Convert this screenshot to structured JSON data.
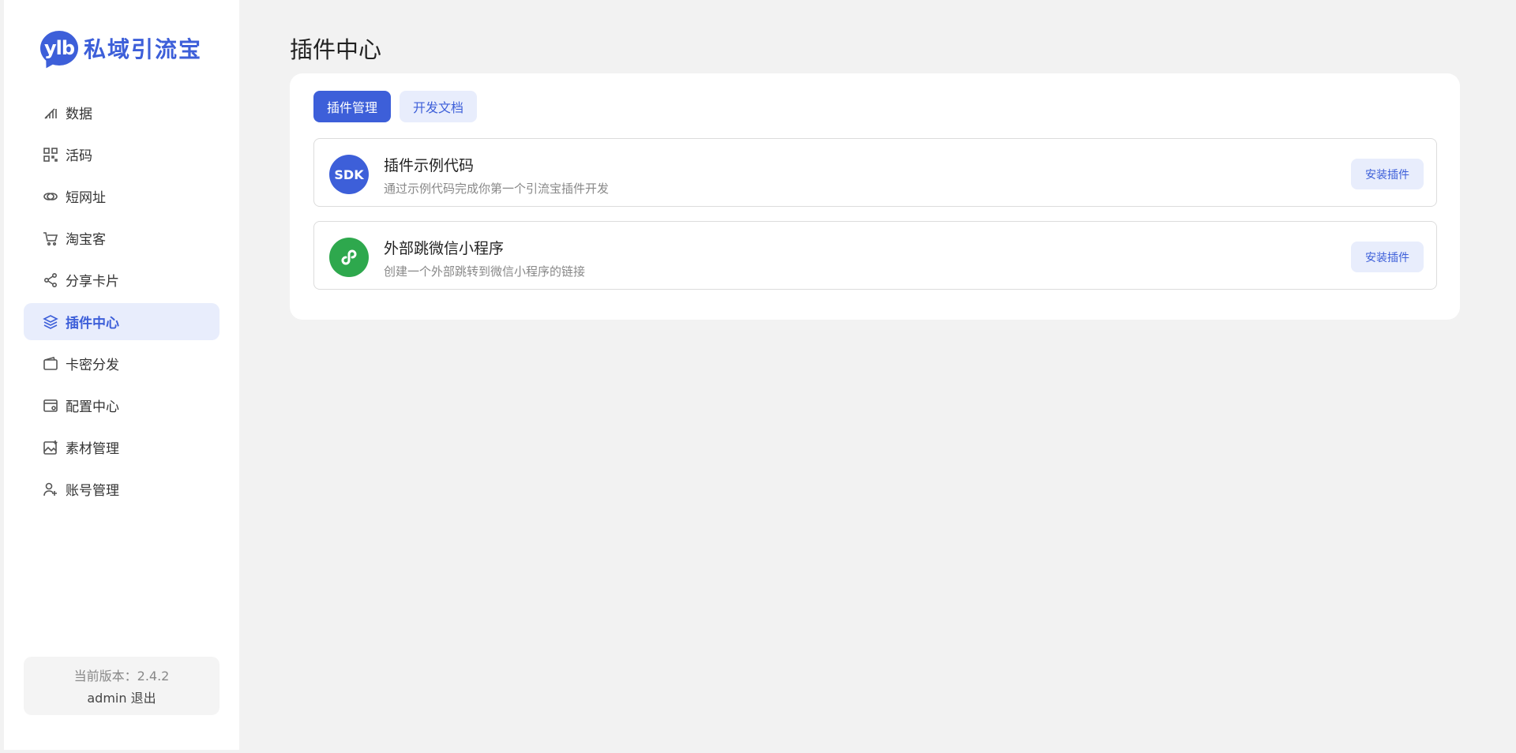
{
  "brand": {
    "badge": "ylb",
    "name": "私域引流宝",
    "color": "#3d5fd9"
  },
  "sidebar": {
    "items": [
      {
        "label": "数据",
        "icon": "chart-icon",
        "active": false
      },
      {
        "label": "活码",
        "icon": "qrcode-icon",
        "active": false
      },
      {
        "label": "短网址",
        "icon": "link-icon",
        "active": false
      },
      {
        "label": "淘宝客",
        "icon": "cart-icon",
        "active": false
      },
      {
        "label": "分享卡片",
        "icon": "share-icon",
        "active": false
      },
      {
        "label": "插件中心",
        "icon": "layers-icon",
        "active": true
      },
      {
        "label": "卡密分发",
        "icon": "wallet-icon",
        "active": false
      },
      {
        "label": "配置中心",
        "icon": "settings-window-icon",
        "active": false
      },
      {
        "label": "素材管理",
        "icon": "image-icon",
        "active": false
      },
      {
        "label": "账号管理",
        "icon": "user-add-icon",
        "active": false
      }
    ],
    "footer": {
      "version_text": "当前版本：2.4.2",
      "username": "admin",
      "logout_label": "退出"
    }
  },
  "main": {
    "title": "插件中心",
    "tabs": [
      {
        "label": "插件管理",
        "active": true
      },
      {
        "label": "开发文档",
        "active": false
      }
    ],
    "plugins": [
      {
        "icon_text": "SDK",
        "icon_color": "#3d5fd9",
        "name": "插件示例代码",
        "description": "通过示例代码完成你第一个引流宝插件开发",
        "button": "安装插件"
      },
      {
        "icon_text": "",
        "icon_color": "#2ea84d",
        "icon": "mini-program-icon",
        "name": "外部跳微信小程序",
        "description": "创建一个外部跳转到微信小程序的链接",
        "button": "安装插件"
      }
    ]
  }
}
